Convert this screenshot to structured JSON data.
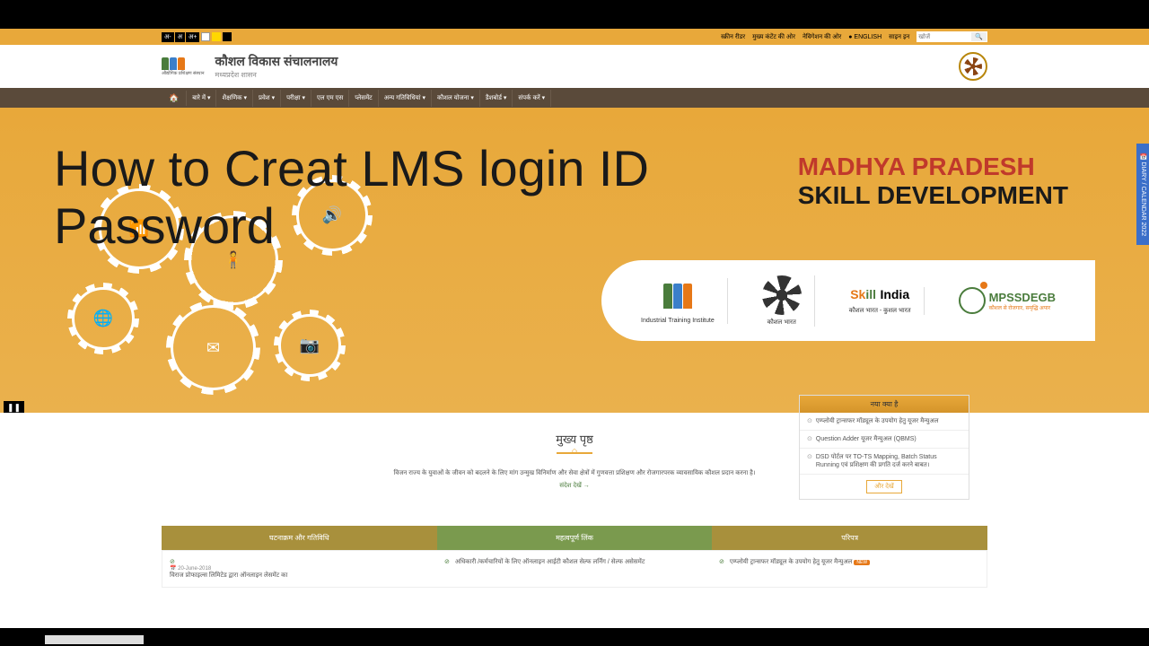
{
  "utilbar": {
    "textsize": [
      "अ-",
      "अ",
      "अ+"
    ],
    "links": [
      "स्क्रीन रीडर",
      "मुख्य कंटेंट की ओर",
      "नेविगेशन की ओर",
      "● ENGLISH",
      "साइन इन"
    ],
    "search_placeholder": "खोजें"
  },
  "header": {
    "logo_sub": "औद्योगिक प्रशिक्षण संस्थान",
    "title": "कौशल विकास संचालनालय",
    "subtitle": "मध्यप्रदेश शासन"
  },
  "nav": [
    "बारे में ▾",
    "शैक्षणिक ▾",
    "प्रवेश ▾",
    "परीक्षा ▾",
    "एल एम एस",
    "प्लेसमेंट",
    "अन्य गतिविधियां ▾",
    "कौशल योजना ▾",
    "डैशबोर्ड ▾",
    "संपर्क करें ▾"
  ],
  "overlay": {
    "line1": "How to Creat LMS login ID",
    "line2": "Password"
  },
  "hero": {
    "title1": "MADHYA PRADESH",
    "title2": "SKILL DEVELOPMENT",
    "brands": {
      "iti_sub": "Industrial Training Institute",
      "emblem_sub": "कौशल भारत",
      "skill_s": "Sk",
      "skill_k": "ill",
      "skill_india": "India",
      "skill_sub": "कौशल भारत - कुशल भारत",
      "mps": "MPSSDEGB",
      "mps_sub": "कौशल से रोजगार, समृद्धि अपार"
    }
  },
  "content": {
    "title": "मुख्य पृष्ठ",
    "text": "विजन राज्य के युवाओं के जीवन को बदलने के लिए मांग उन्मुख विनिर्माण और सेवा क्षेत्रों में गुणवत्ता प्रशिक्षण और रोजगारपरक व्यावसायिक कौशल प्रदान करना है।",
    "link": "संदेश देखें →"
  },
  "whatsnew": {
    "head": "नया क्या है",
    "items": [
      "एम्प्लोयी ट्रान्सफर मॉड्यूल के उपयोग हेतु यूजर मैन्युअल",
      "Question Adder यूजर मैन्युअल (QBMS)",
      "DSD पोर्टल पर TO-TS Mapping, Batch Status Running एवं प्रशिक्षण की प्रगति दर्ज करने बाबत।"
    ],
    "more": "और देखें"
  },
  "tabs": {
    "headers": [
      "घटनाक्रम और गतिविधि",
      "महत्वपूर्ण लिंक",
      "परिपत्र"
    ],
    "col1_date": "📅 20-June-2018",
    "col1_text": "विराज प्रोफाइल्स लिमिटेड द्वारा ऑनलाइन लेसमेंट का",
    "col2_text": "अधिकारी /कर्मचारियों के लिए ऑनलाइन आईटी कौशल सेल्फ लर्निंग / सेल्फ असेसमेंट",
    "col3_text": "एम्प्लोयी ट्रान्सफर मॉड्यूल के उपयोग हेतु यूजर मैन्युअल",
    "new": "NEW"
  },
  "sidebar_tab": "📅 DIARY / CALENDAR 2022"
}
